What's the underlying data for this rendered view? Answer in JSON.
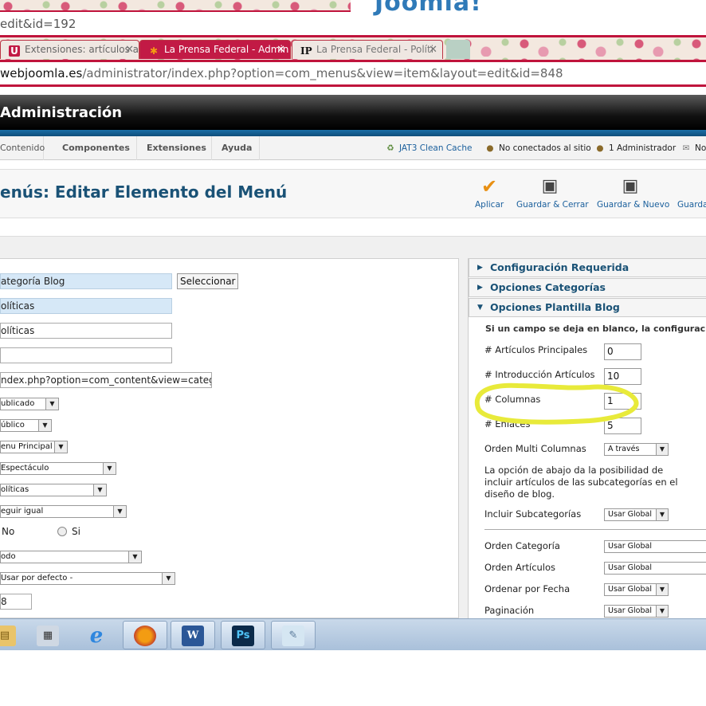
{
  "browser": {
    "prev_url_fragment": "edit&id=192",
    "header_logo_text": "Joomla!",
    "tabs": [
      {
        "label": "Extensiones: artículos autó",
        "favicon": "U"
      },
      {
        "label": "La Prensa Federal - Admin",
        "favicon": "joomla-icon"
      },
      {
        "label": "La Prensa Federal - Políti",
        "favicon": "IP"
      }
    ],
    "url_host": "webjoomla.es",
    "url_path": "/administrator/index.php?option=com_menus&view=item&layout=edit&id=848",
    "accent_color": "#c0143c"
  },
  "admin": {
    "title": "Administración",
    "menu": [
      "Contenido",
      "Componentes",
      "Extensiones",
      "Ayuda"
    ],
    "status": {
      "cache": "JAT3 Clean Cache",
      "site": "No conectados al sitio",
      "admins": "1 Administrador",
      "extra": "No"
    }
  },
  "toolbar": {
    "page_title": "enús: Editar Elemento del Menú",
    "apply": "Aplicar",
    "save_close": "Guardar & Cerrar",
    "save_new": "Guardar & Nuevo",
    "save_more": "Guarda"
  },
  "left_form": {
    "menu_type": "ategoría Blog",
    "select_button": "Seleccionar",
    "title": "olíticas",
    "alias": "olíticas",
    "note": "",
    "link": "ndex.php?option=com_content&view=category&lay",
    "status": "ublicado",
    "access": "úblico",
    "menu_location": "enu Principal",
    "parent": "Espectáculo",
    "ordering": "olíticas",
    "target": "eguir igual",
    "default_no": "No",
    "default_si": "Si",
    "language": "odo",
    "template_style": "Usar por defecto -",
    "id": "8"
  },
  "right_panel": {
    "sections": {
      "required": "Configuración Requerida",
      "categories": "Opciones Categorías",
      "blog": "Opciones Plantilla Blog"
    },
    "blog_intro": "Si un campo se deja en blanco, la configuración g",
    "fields": {
      "leading_label": "# Artículos Principales",
      "leading_value": "0",
      "intro_label": "# Introducción Artículos",
      "intro_value": "10",
      "columns_label": "# Columnas",
      "columns_value": "1",
      "links_label": "# Enlaces",
      "links_value": "5",
      "multi_col_label": "Orden Multi Columnas",
      "multi_col_value": "A través"
    },
    "subcat_help": "La opción de abajo da la posibilidad de incluir artículos de las subcategorías en el diseño de blog.",
    "include_subcat_label": "Incluir Subcategorías",
    "include_subcat_value": "Usar Global",
    "order_cat_label": "Orden Categoría",
    "order_cat_value": "Usar Global",
    "order_art_label": "Orden Artículos",
    "order_art_value": "Usar Global",
    "order_date_label": "Ordenar por Fecha",
    "order_date_value": "Usar Global",
    "pagination_label": "Paginación",
    "pagination_value": "Usar Global"
  },
  "annotation_color": "#e8ea3a",
  "taskbar": [
    "file-explorer-icon",
    "calculator-icon",
    "internet-explorer-icon",
    "firefox-icon",
    "word-icon",
    "photoshop-icon",
    "notepad-icon"
  ]
}
